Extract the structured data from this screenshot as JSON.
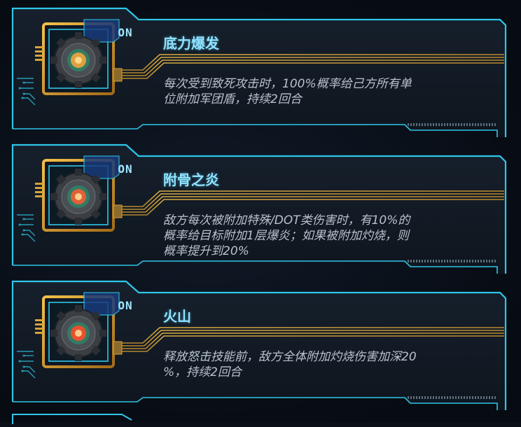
{
  "skills": [
    {
      "status": "ON",
      "name": "底力爆发",
      "desc_lines": [
        "每次受到致死攻击时，100%概率给己方所有单",
        "位附加军团盾，持续2回合"
      ],
      "emblem_color": "#e0a040",
      "icon": "shield-emblem-icon"
    },
    {
      "status": "ON",
      "name": "附骨之炎",
      "desc_lines": [
        "敌方每次被附加特殊/DOT类伤害时，有10%的",
        "概率给目标附加1层爆炎；如果被附加灼烧，则",
        "概率提升到20%"
      ],
      "emblem_color": "#e0603a",
      "icon": "flame-emblem-icon"
    },
    {
      "status": "ON",
      "name": "火山",
      "desc_lines": [
        "释放怒击技能前，敌方全体附加灼烧伤害加深20",
        "%，持续2回合"
      ],
      "emblem_color": "#e85030",
      "icon": "volcano-emblem-icon"
    }
  ],
  "colors": {
    "frame": "#2fc6e8",
    "title": "#8fe4ff",
    "desc": "#b9c2cc",
    "gold": "#d7a33a"
  }
}
